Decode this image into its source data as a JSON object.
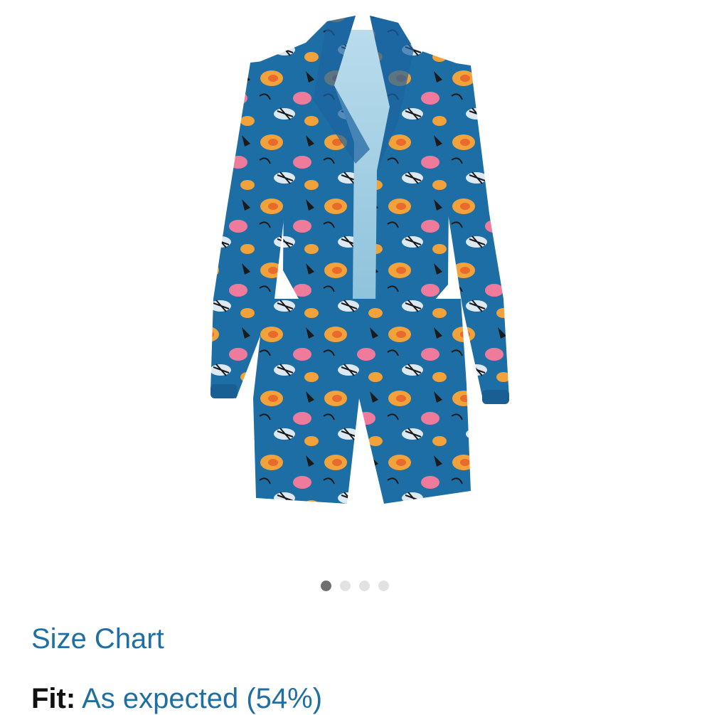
{
  "product": {
    "image_alt": "Floral print blazer and shorts two-piece set",
    "image_count": 4,
    "active_image_index": 0,
    "fabric_color": "#1e6ea6",
    "accent_colors": [
      "#f2a23a",
      "#e86a2c",
      "#ee7a9c",
      "#1a1a1a",
      "#ffffff"
    ]
  },
  "links": {
    "size_chart": "Size Chart"
  },
  "fit": {
    "label": "Fit:",
    "value": "As expected (54%)"
  },
  "colors": {
    "link": "#1f6fa3",
    "text": "#111111",
    "dot_active": "#6f6f6f",
    "dot_inactive": "#e2e2e2"
  }
}
